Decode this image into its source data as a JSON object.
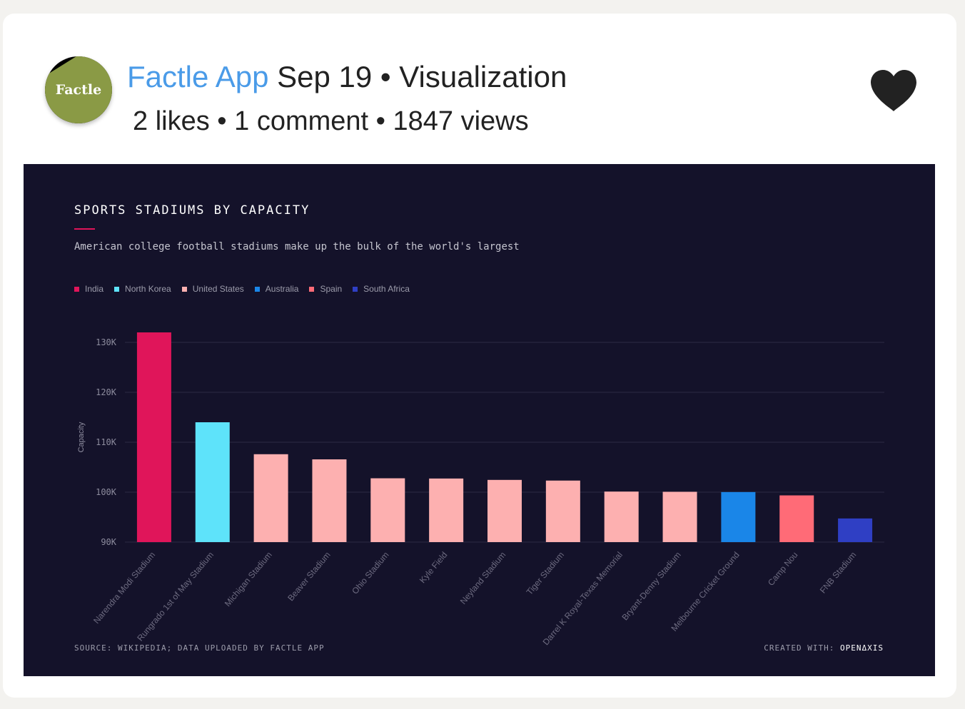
{
  "post": {
    "app_name": "Factle App",
    "meta_line": "Sep 19 • Visualization",
    "stats_line": "2 likes • 1 comment • 1847 views",
    "avatar_text": "Factle",
    "like_icon": "heart-icon"
  },
  "chart_data": {
    "type": "bar",
    "title": "SPORTS STADIUMS BY CAPACITY",
    "subtitle": "American college football stadiums make up the bulk of the world's largest",
    "ylabel": "Capacity",
    "xlabel": "",
    "ylim": [
      90000,
      132000
    ],
    "yticks": [
      90000,
      100000,
      110000,
      120000,
      130000
    ],
    "ytick_labels": [
      "90K",
      "100K",
      "110K",
      "120K",
      "130K"
    ],
    "grid": true,
    "legend_position": "top-left",
    "legend": [
      {
        "name": "India",
        "color": "#e0155a"
      },
      {
        "name": "North Korea",
        "color": "#5ee3fa"
      },
      {
        "name": "United States",
        "color": "#fdb0b0"
      },
      {
        "name": "Australia",
        "color": "#1a86e8"
      },
      {
        "name": "Spain",
        "color": "#ff6b77"
      },
      {
        "name": "South Africa",
        "color": "#2f3fc4"
      }
    ],
    "bars": [
      {
        "category": "Narendra Modi Stadium",
        "value": 132000,
        "country": "India",
        "color": "#e0155a"
      },
      {
        "category": "Rungrado 1st of May Stadium",
        "value": 114000,
        "country": "North Korea",
        "color": "#5ee3fa"
      },
      {
        "category": "Michigan Stadium",
        "value": 107601,
        "country": "United States",
        "color": "#fdb0b0"
      },
      {
        "category": "Beaver Stadium",
        "value": 106572,
        "country": "United States",
        "color": "#fdb0b0"
      },
      {
        "category": "Ohio Stadium",
        "value": 102780,
        "country": "United States",
        "color": "#fdb0b0"
      },
      {
        "category": "Kyle Field",
        "value": 102733,
        "country": "United States",
        "color": "#fdb0b0"
      },
      {
        "category": "Neyland Stadium",
        "value": 102455,
        "country": "United States",
        "color": "#fdb0b0"
      },
      {
        "category": "Tiger Stadium",
        "value": 102321,
        "country": "United States",
        "color": "#fdb0b0"
      },
      {
        "category": "Darrel K Royal-Texas Memorial",
        "value": 100119,
        "country": "United States",
        "color": "#fdb0b0"
      },
      {
        "category": "Bryant-Denny Stadium",
        "value": 100077,
        "country": "United States",
        "color": "#fdb0b0"
      },
      {
        "category": "Melbourne Cricket Ground",
        "value": 100024,
        "country": "Australia",
        "color": "#1a86e8"
      },
      {
        "category": "Camp Nou",
        "value": 99354,
        "country": "Spain",
        "color": "#ff6b77"
      },
      {
        "category": "FNB Stadium",
        "value": 94736,
        "country": "South Africa",
        "color": "#2f3fc4"
      }
    ],
    "source": "SOURCE: WIKIPEDIA; DATA UPLOADED BY FACTLE APP",
    "created_with_label": "CREATED WITH:",
    "created_with_brand": "OPENΔXIS"
  }
}
